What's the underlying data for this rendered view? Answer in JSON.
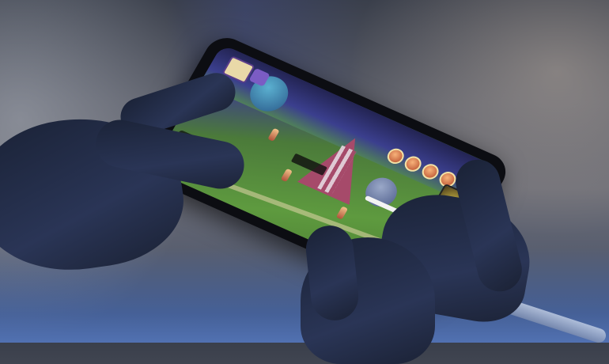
{
  "scene": {
    "subject": "hands-holding-smartphone-playing-game",
    "game": {
      "hud": {
        "skill_icons": [
          "skill-icon",
          "skill-icon",
          "skill-icon",
          "skill-icon",
          "skill-icon"
        ],
        "action_buttons": [
          "action-button",
          "action-button",
          "action-button",
          "action-button"
        ],
        "has_minimap": true
      }
    }
  },
  "colors": {
    "lighting": "#5a82d8",
    "grass": "#5e9a3f",
    "tent": "#a64a6a",
    "phone": "#0c0d12"
  }
}
